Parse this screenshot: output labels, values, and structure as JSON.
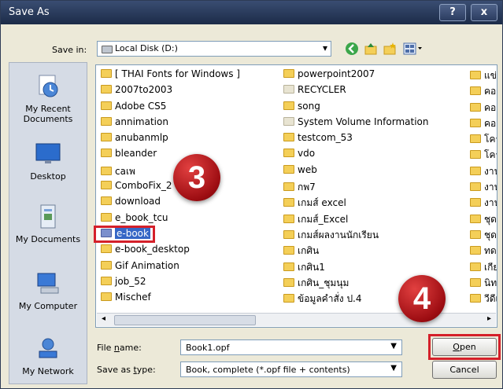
{
  "window": {
    "title": "Save As",
    "help_label": "?",
    "close_label": "x"
  },
  "toolbar": {
    "save_in_label": "Save in:",
    "save_in_value": "Local Disk (D:)",
    "icons": [
      "back-icon",
      "up-folder-icon",
      "new-folder-icon",
      "views-menu-icon"
    ]
  },
  "places": [
    {
      "label": "My Recent Documents",
      "icon": "recent-documents-icon"
    },
    {
      "label": "Desktop",
      "icon": "desktop-icon"
    },
    {
      "label": "My Documents",
      "icon": "my-documents-icon"
    },
    {
      "label": "My Computer",
      "icon": "my-computer-icon"
    },
    {
      "label": "My Network",
      "icon": "my-network-icon"
    }
  ],
  "files": {
    "col1": [
      "[ THAI Fonts for Windows ]",
      "2007to2003",
      "Adobe CS5",
      "annimation",
      "anubanmlp",
      "bleander",
      "caเพ",
      "ComboFix_2",
      "download",
      "e_book_tcu",
      "e-book",
      "e-book_desktop",
      "Gif Animation",
      "job_52",
      "Mischef"
    ],
    "col2": [
      "powerpoint2007",
      "RECYCLER",
      "song",
      "System Volume Information",
      "testcom_53",
      "vdo",
      "web",
      "กพ7",
      "เกมส์ excel",
      "เกมส์_Excel",
      "เกมส์ผลงานนักเรียน",
      "เกศิน",
      "เกศิน1",
      "เกศิน_ชุมนุม",
      "ข้อมูลคำสั่ง ป.4"
    ],
    "col3": [
      "แข่ง",
      "คอม",
      "คอม",
      "คอม",
      "โครง",
      "โครง",
      "งาน",
      "งาน",
      "งาน",
      "ชุดก",
      "ชุดก",
      "ทดล",
      "เกีย",
      "นิทา",
      "วีดีเ"
    ],
    "selected": "e-book"
  },
  "filename": {
    "label_prefix": "File ",
    "label_u": "n",
    "label_suffix": "ame:",
    "value": "Book1.opf"
  },
  "savetype": {
    "label_prefix": "Save as ",
    "label_u": "t",
    "label_suffix": "ype:",
    "value": "Book, complete (*.opf file + contents)"
  },
  "buttons": {
    "open_u": "O",
    "open_rest": "pen",
    "cancel": "Cancel"
  },
  "annotations": {
    "step3": "3",
    "step4": "4"
  },
  "colors": {
    "annotation_red": "#d4202a",
    "selection_blue": "#3567c6",
    "folder_yellow": "#f4cf58"
  }
}
